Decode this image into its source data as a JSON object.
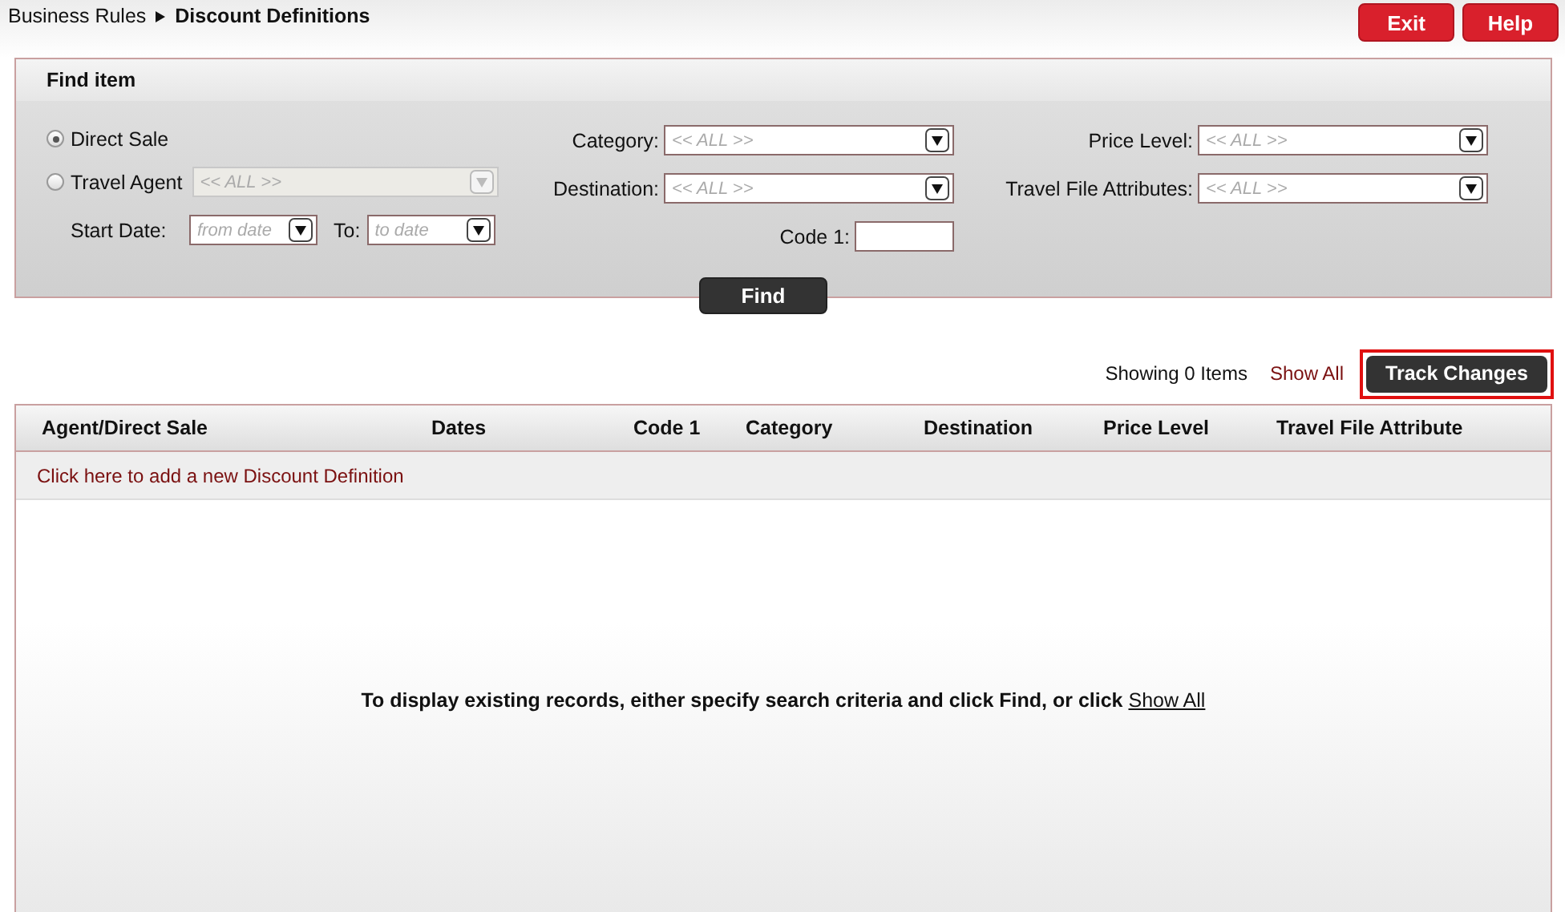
{
  "breadcrumb": {
    "parent": "Business Rules",
    "current": "Discount Definitions"
  },
  "header_buttons": [
    {
      "label": "Exit"
    },
    {
      "label": "Help"
    }
  ],
  "find_panel": {
    "title": "Find item",
    "sale_type": [
      {
        "label": "Direct Sale",
        "selected": true
      },
      {
        "label": "Travel Agent",
        "selected": false
      }
    ],
    "travel_agent_select": {
      "value": "<< ALL >>",
      "disabled": true
    },
    "start_date": {
      "label": "Start Date:",
      "placeholder": "from date"
    },
    "to_date": {
      "label": "To:",
      "placeholder": "to date"
    },
    "middle_fields": [
      {
        "label": "Category:",
        "kind": "select",
        "value": "<< ALL >>"
      },
      {
        "label": "Destination:",
        "kind": "select",
        "value": "<< ALL >>"
      },
      {
        "label": "Code 1:",
        "kind": "text"
      }
    ],
    "right_fields": [
      {
        "label": "Price Level:",
        "kind": "select",
        "value": "<< ALL >>"
      },
      {
        "label": "Travel File Attributes:",
        "kind": "select",
        "value": "<< ALL >>"
      }
    ],
    "find_button": "Find"
  },
  "results": {
    "count": "Showing 0 Items",
    "show_all": "Show All",
    "track_changes": {
      "label": "Track Changes",
      "highlighted": true
    }
  },
  "table": {
    "columns": [
      "Agent/Direct Sale",
      "Dates",
      "Code 1",
      "Category",
      "Destination",
      "Price Level",
      "Travel File Attribute"
    ],
    "add_row_link": "Click here to add a new Discount Definition",
    "empty_message": {
      "text": "To display existing records, either specify search criteria and click Find, or click",
      "link": "Show All"
    }
  }
}
